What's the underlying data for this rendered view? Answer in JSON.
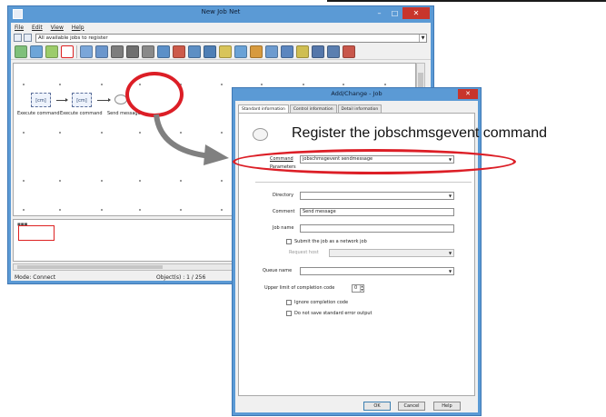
{
  "main_window": {
    "title": "New Job Net",
    "menu": [
      "File",
      "Edit",
      "View",
      "Help"
    ],
    "job_selector": "All available jobs to register",
    "nodes": [
      {
        "label": "Execute command",
        "icon_text": "[cm]"
      },
      {
        "label": "Execute command",
        "icon_text": "[cm]"
      },
      {
        "label": "Send message"
      }
    ],
    "status": {
      "mode": "Mode: Connect",
      "objects": "Object(s) : 1 / 256"
    }
  },
  "dialog": {
    "title": "Add/Change - Job",
    "tabs": [
      "Standard information",
      "Control information",
      "Detail information"
    ],
    "overlay_title": "Register the jobschmsgevent command",
    "fields": {
      "command": {
        "label": "Command",
        "value": "jobschmsgevent sendmessage"
      },
      "parameters": {
        "label": "Parameters",
        "value": ""
      },
      "directory": {
        "label": "Directory",
        "value": ""
      },
      "comment": {
        "label": "Comment",
        "value": "Send message"
      },
      "job_name": {
        "label": "Job name",
        "value": ""
      },
      "submit_network": {
        "label": "Submit the job as a network job"
      },
      "request_host": {
        "label": "Request host",
        "value": ""
      },
      "queue_name": {
        "label": "Queue name",
        "value": ""
      },
      "upper_limit": {
        "label": "Upper limit of completion code",
        "value": "0"
      },
      "ignore_completion": {
        "label": "Ignore completion code"
      },
      "do_not_save": {
        "label": "Do not save standard error output"
      }
    },
    "buttons": {
      "ok": "OK",
      "cancel": "Cancel",
      "help": "Help"
    }
  },
  "colors": {
    "title_bar": "#5b9ad5",
    "callout_red": "#dc1e26",
    "close_button": "#c8352c"
  }
}
